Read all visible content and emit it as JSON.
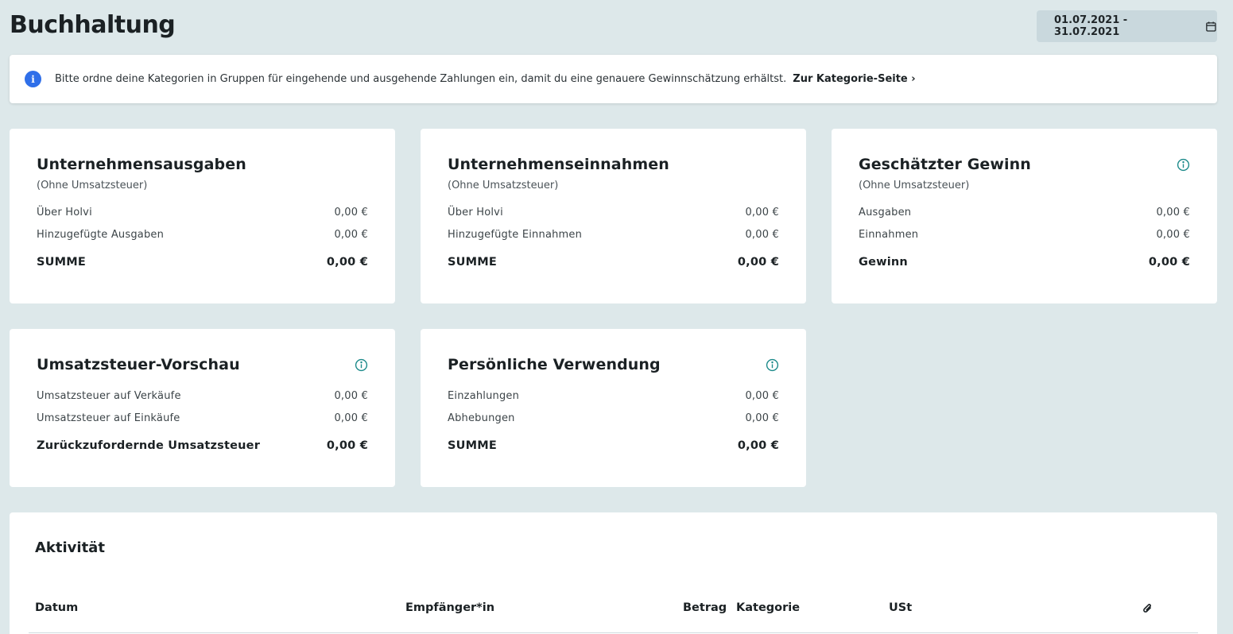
{
  "page": {
    "title": "Buchhaltung",
    "date_range": "01.07.2021 - 31.07.2021"
  },
  "banner": {
    "icon_letter": "i",
    "text": "Bitte ordne deine Kategorien in Gruppen für eingehende und ausgehende Zahlungen ein, damit du eine genauere Gewinnschätzung erhältst.",
    "link": "Zur Kategorie-Seite ›"
  },
  "cards": {
    "expenses": {
      "title": "Unternehmensausgaben",
      "subtitle": "(Ohne Umsatzsteuer)",
      "rows": [
        {
          "label": "Über Holvi",
          "value": "0,00 €"
        },
        {
          "label": "Hinzugefügte Ausgaben",
          "value": "0,00 €"
        }
      ],
      "sum": {
        "label": "SUMME",
        "value": "0,00 €"
      }
    },
    "income": {
      "title": "Unternehmenseinnahmen",
      "subtitle": "(Ohne Umsatzsteuer)",
      "rows": [
        {
          "label": "Über Holvi",
          "value": "0,00 €"
        },
        {
          "label": "Hinzugefügte Einnahmen",
          "value": "0,00 €"
        }
      ],
      "sum": {
        "label": "SUMME",
        "value": "0,00 €"
      }
    },
    "profit": {
      "title": "Geschätzter Gewinn",
      "subtitle": "(Ohne Umsatzsteuer)",
      "rows": [
        {
          "label": "Ausgaben",
          "value": "0,00 €"
        },
        {
          "label": "Einnahmen",
          "value": "0,00 €"
        }
      ],
      "sum": {
        "label": "Gewinn",
        "value": "0,00 €"
      }
    },
    "vat": {
      "title": "Umsatzsteuer-Vorschau",
      "rows": [
        {
          "label": "Umsatzsteuer auf Verkäufe",
          "value": "0,00 €"
        },
        {
          "label": "Umsatzsteuer auf Einkäufe",
          "value": "0,00 €"
        }
      ],
      "sum": {
        "label": "Zurückzufordernde Umsatzsteuer",
        "value": "0,00 €"
      }
    },
    "personal": {
      "title": "Persönliche Verwendung",
      "rows": [
        {
          "label": "Einzahlungen",
          "value": "0,00 €"
        },
        {
          "label": "Abhebungen",
          "value": "0,00 €"
        }
      ],
      "sum": {
        "label": "SUMME",
        "value": "0,00 €"
      }
    }
  },
  "activity": {
    "title": "Aktivität",
    "columns": [
      "Datum",
      "Empfänger*in",
      "Betrag",
      "Kategorie",
      "USt"
    ],
    "attachment_icon": "paperclip-icon"
  },
  "colors": {
    "background": "#dde8ea",
    "info_blue": "#2f6fe9",
    "info_icon_teal": "#1c8a8a"
  }
}
